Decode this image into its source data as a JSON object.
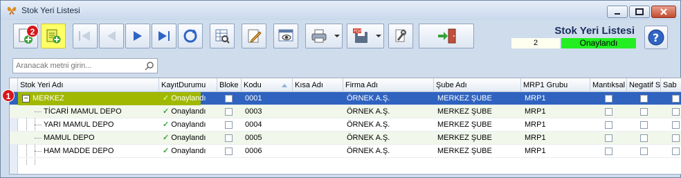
{
  "window": {
    "title": "Stok Yeri Listesi"
  },
  "toolbar": {
    "buttons": [
      {
        "name": "add-button",
        "icon": "add-icon"
      },
      {
        "name": "add-sub-button",
        "icon": "add-sub-icon"
      },
      {
        "name": "first-button",
        "icon": "first-icon"
      },
      {
        "name": "prev-button",
        "icon": "prev-icon"
      },
      {
        "name": "next-button",
        "icon": "next-icon"
      },
      {
        "name": "last-button",
        "icon": "last-icon"
      },
      {
        "name": "refresh-button",
        "icon": "refresh-icon"
      },
      {
        "name": "grid-search-button",
        "icon": "grid-search-icon"
      },
      {
        "name": "edit-button",
        "icon": "edit-icon"
      },
      {
        "name": "view-button",
        "icon": "view-icon"
      },
      {
        "name": "print-button",
        "icon": "printer-icon"
      },
      {
        "name": "pdf-save-button",
        "icon": "pdf-save-icon"
      },
      {
        "name": "settings-button",
        "icon": "tools-icon"
      },
      {
        "name": "exit-button",
        "icon": "exit-icon"
      }
    ],
    "badge2": "2"
  },
  "header": {
    "title": "Stok Yeri Listesi",
    "record_count": "2",
    "status": "Onaylandı",
    "status_color": "#22ee22"
  },
  "search": {
    "placeholder": "Aranacak metni girin..."
  },
  "grid": {
    "badge1": "1",
    "columns": [
      "Stok Yeri Adı",
      "KayıtDurumu",
      "Bloke",
      "Kodu",
      "Kısa Adı",
      "Firma Adı",
      "Şube Adı",
      "MRP1 Grubu",
      "Mantıksal",
      "Negatif S",
      "Sab"
    ],
    "rows": [
      {
        "name": "MERKEZ",
        "status": "Onaylandı",
        "code": "0001",
        "short": "",
        "firm": "ÖRNEK A.Ş.",
        "branch": "MERKEZ ŞUBE",
        "mrp": "MRP1"
      },
      {
        "name": "TİCARİ MAMUL DEPO",
        "status": "Onaylandı",
        "code": "0003",
        "short": "",
        "firm": "ÖRNEK A.Ş.",
        "branch": "MERKEZ ŞUBE",
        "mrp": "MRP1"
      },
      {
        "name": "YARI MAMUL DEPO",
        "status": "Onaylandı",
        "code": "0004",
        "short": "",
        "firm": "ÖRNEK A.Ş.",
        "branch": "MERKEZ ŞUBE",
        "mrp": "MRP1"
      },
      {
        "name": "MAMUL DEPO",
        "status": "Onaylandı",
        "code": "0005",
        "short": "",
        "firm": "ÖRNEK A.Ş.",
        "branch": "MERKEZ ŞUBE",
        "mrp": "MRP1"
      },
      {
        "name": "HAM MADDE DEPO",
        "status": "Onaylandı",
        "code": "0006",
        "short": "",
        "firm": "ÖRNEK A.Ş.",
        "branch": "MERKEZ ŞUBE",
        "mrp": "MRP1"
      }
    ]
  },
  "colors": {
    "accent": "#2f63bf",
    "highlight": "#ffff66",
    "badge": "#d8161b"
  }
}
